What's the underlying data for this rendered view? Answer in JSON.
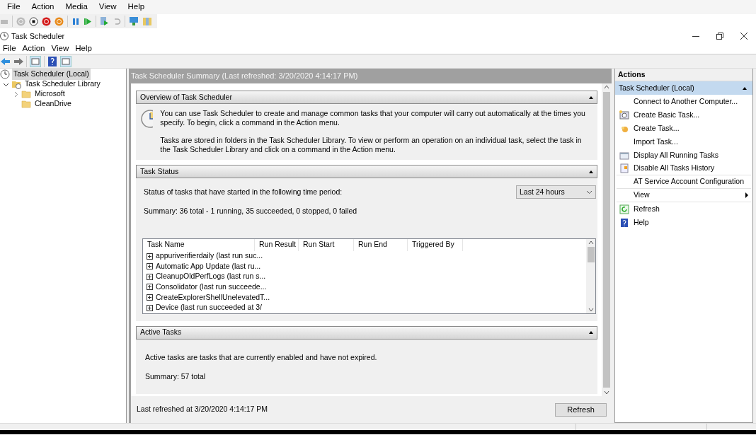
{
  "host_menu": [
    "File",
    "Action",
    "Media",
    "View",
    "Help"
  ],
  "window": {
    "title": "Task Scheduler"
  },
  "menu": [
    "File",
    "Action",
    "View",
    "Help"
  ],
  "tree": [
    {
      "label": "Task Scheduler (Local)",
      "selected": true,
      "children": [
        {
          "label": "Task Scheduler Library",
          "selected": false,
          "expanded": true,
          "children": [
            {
              "label": "Microsoft",
              "selected": false,
              "expanded": false
            },
            {
              "label": "CleanDrive",
              "selected": false
            }
          ]
        }
      ]
    }
  ],
  "summary": {
    "title": "Task Scheduler Summary (Last refreshed: 3/20/2020 4:14:17 PM)",
    "sections": [
      {
        "kind": "overview",
        "title": "Overview of Task Scheduler",
        "expanded": true,
        "paragraphs": [
          "You can use Task Scheduler to create and manage common tasks that your computer will carry out automatically at the times you specify. To begin, click a command in the Action menu.",
          "Tasks are stored in folders in the Task Scheduler Library. To view or perform an operation on an individual task, select the task in the Task Scheduler Library and click on a command in the Action menu."
        ]
      },
      {
        "kind": "status",
        "title": "Task Status",
        "expanded": true,
        "period_label": "Status of tasks that have started in the following time period:",
        "period": "Last 24 hours",
        "summary": "Summary: 36 total - 1 running, 35 succeeded, 0 stopped, 0 failed",
        "table": {
          "columns": [
            "Task Name",
            "Run Result",
            "Run Start",
            "Run End",
            "Triggered By"
          ],
          "rows": [
            {
              "name": "appuriverifierdaily (last run suc..."
            },
            {
              "name": "Automatic App Update (last ru..."
            },
            {
              "name": "CleanupOldPerfLogs (last run s..."
            },
            {
              "name": "Consolidator (last run succeede..."
            },
            {
              "name": "CreateExplorerShellUnelevatedT..."
            },
            {
              "name": "Device (last run succeeded at 3/"
            }
          ]
        }
      },
      {
        "kind": "active",
        "title": "Active Tasks",
        "expanded": true,
        "paragraphs": [
          "Active tasks are tasks that are currently enabled and have not expired.",
          "Summary: 57 total"
        ]
      }
    ],
    "footer": {
      "text": "Last refreshed at 3/20/2020 4:14:17 PM",
      "button": "Refresh"
    }
  },
  "actions": {
    "title": "Actions",
    "group": {
      "title": "Task Scheduler (Local)",
      "expanded": true,
      "items": [
        {
          "label": "Connect to Another Computer...",
          "kind": "plain"
        },
        {
          "label": "Create Basic Task...",
          "kind": "basic-task"
        },
        {
          "label": "Create Task...",
          "kind": "create-task"
        },
        {
          "label": "Import Task...",
          "kind": "plain"
        },
        {
          "label": "Display All Running Tasks",
          "kind": "running"
        },
        {
          "label": "Disable All Tasks History",
          "kind": "history",
          "separator_after": true
        },
        {
          "label": "AT Service Account Configuration",
          "kind": "plain",
          "separator_after": true
        },
        {
          "label": "View",
          "kind": "submenu",
          "separator_after": true
        },
        {
          "label": "Refresh",
          "kind": "refresh"
        },
        {
          "label": "Help",
          "kind": "help"
        }
      ]
    }
  }
}
